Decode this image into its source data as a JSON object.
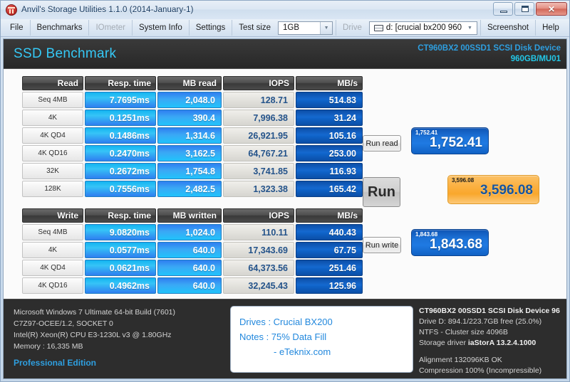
{
  "window": {
    "title": "Anvil's Storage Utilities 1.1.0 (2014-January-1)",
    "icon": "anvil-icon",
    "minimize": "minimize-icon",
    "maximize": "maximize-icon",
    "close": "✕"
  },
  "menu": {
    "items": [
      {
        "label": "File",
        "disabled": false
      },
      {
        "label": "Benchmarks",
        "disabled": false
      },
      {
        "label": "IOmeter",
        "disabled": true
      },
      {
        "label": "System Info",
        "disabled": false
      },
      {
        "label": "Settings",
        "disabled": false
      }
    ],
    "test_size_label": "Test size",
    "test_size_value": "1GB",
    "drive_label": "Drive",
    "drive_value": "d: [crucial bx200 960",
    "trailing": [
      {
        "label": "Screenshot",
        "disabled": false
      },
      {
        "label": "Help",
        "disabled": false
      }
    ]
  },
  "header": {
    "title": "SSD Benchmark",
    "device_name": "CT960BX2 00SSD1 SCSI Disk Device",
    "device_capacity": "960GB/MU01",
    "accent": "#35c8f5"
  },
  "read_table": {
    "headers": [
      "Read",
      "Resp. time",
      "MB read",
      "IOPS",
      "MB/s"
    ],
    "rows": [
      {
        "label": "Seq 4MB",
        "resp": "7.7695ms",
        "mb": "2,048.0",
        "iops": "128.71",
        "mbs": "514.83"
      },
      {
        "label": "4K",
        "resp": "0.1251ms",
        "mb": "390.4",
        "iops": "7,996.38",
        "mbs": "31.24"
      },
      {
        "label": "4K QD4",
        "resp": "0.1486ms",
        "mb": "1,314.6",
        "iops": "26,921.95",
        "mbs": "105.16"
      },
      {
        "label": "4K QD16",
        "resp": "0.2470ms",
        "mb": "3,162.5",
        "iops": "64,767.21",
        "mbs": "253.00"
      },
      {
        "label": "32K",
        "resp": "0.2672ms",
        "mb": "1,754.8",
        "iops": "3,741.85",
        "mbs": "116.93"
      },
      {
        "label": "128K",
        "resp": "0.7556ms",
        "mb": "2,482.5",
        "iops": "1,323.38",
        "mbs": "165.42"
      }
    ]
  },
  "write_table": {
    "headers": [
      "Write",
      "Resp. time",
      "MB written",
      "IOPS",
      "MB/s"
    ],
    "rows": [
      {
        "label": "Seq 4MB",
        "resp": "9.0820ms",
        "mb": "1,024.0",
        "iops": "110.11",
        "mbs": "440.43"
      },
      {
        "label": "4K",
        "resp": "0.0577ms",
        "mb": "640.0",
        "iops": "17,343.69",
        "mbs": "67.75"
      },
      {
        "label": "4K QD4",
        "resp": "0.0621ms",
        "mb": "640.0",
        "iops": "64,373.56",
        "mbs": "251.46"
      },
      {
        "label": "4K QD16",
        "resp": "0.4962ms",
        "mb": "640.0",
        "iops": "32,245.43",
        "mbs": "125.96"
      }
    ]
  },
  "scores": {
    "run_read_label": "Run read",
    "run_label": "Run",
    "run_write_label": "Run write",
    "read_score_small": "1,752.41",
    "read_score": "1,752.41",
    "total_score_small": "3,596.08",
    "total_score": "3,596.08",
    "write_score_small": "1,843.68",
    "write_score": "1,843.68",
    "blue": "#1c72d8",
    "orange": "#fbb040"
  },
  "footer": {
    "system": [
      "Microsoft Windows 7 Ultimate  64-bit Build (7601)",
      "C7Z97-OCEE/1.2, SOCKET 0",
      "Intel(R) Xeon(R) CPU E3-1230L v3 @ 1.80GHz",
      "Memory : 16,335 MB"
    ],
    "edition": "Professional Edition",
    "notes": {
      "drives_line": "Drives : Crucial BX200",
      "notes_line": "Notes :  75% Data Fill",
      "credit_line": "- eTeknix.com"
    },
    "drive": {
      "device": "CT960BX2 00SSD1 SCSI Disk Device 96",
      "free": "Drive D: 894.1/223.7GB free (25.0%)",
      "fs": "NTFS - Cluster size 4096B",
      "driver_label": "Storage driver",
      "driver_value": "iaStorA 13.2.4.1000",
      "alignment": "Alignment 132096KB OK",
      "compression": "Compression 100% (Incompressible)"
    }
  }
}
